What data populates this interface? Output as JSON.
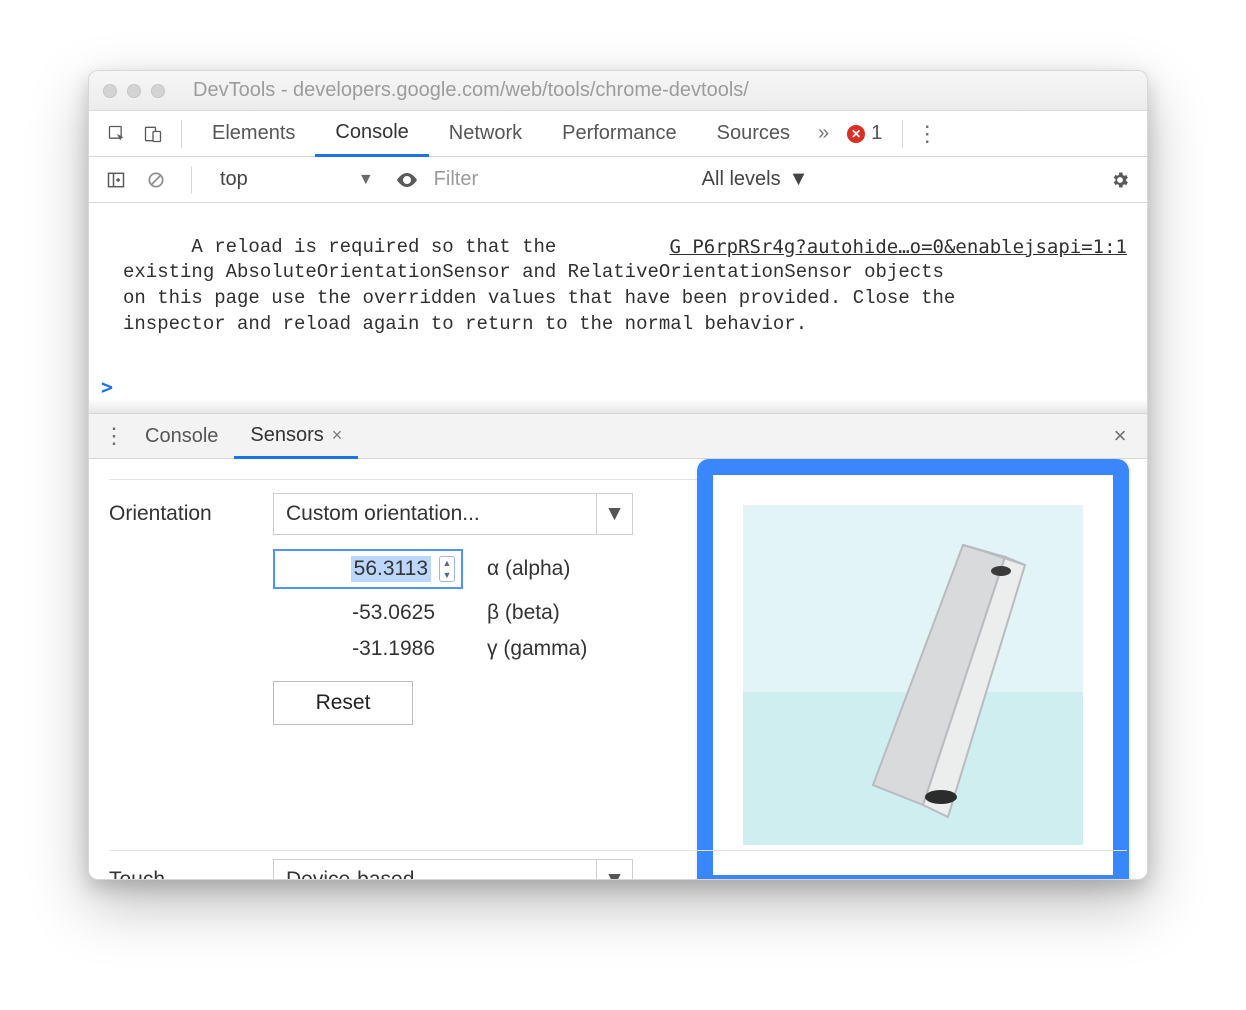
{
  "window": {
    "title": "DevTools - developers.google.com/web/tools/chrome-devtools/"
  },
  "tabs": {
    "items": [
      "Elements",
      "Console",
      "Network",
      "Performance",
      "Sources"
    ],
    "active": "Console",
    "overflow_glyph": "»",
    "error_count": "1"
  },
  "console_toolbar": {
    "context": "top",
    "filter_placeholder": "Filter",
    "levels_label": "All levels"
  },
  "console": {
    "source_link": "G P6rpRSr4g?autohide…o=0&enablejsapi=1:1",
    "msg_line1_prefix": "A reload is required so that the ",
    "msg_line2": "existing AbsoluteOrientationSensor and RelativeOrientationSensor objects",
    "msg_line3": "on this page use the overridden values that have been provided. Close the",
    "msg_line4": "inspector and reload again to return to the normal behavior.",
    "prompt": ">"
  },
  "drawer": {
    "tabs": [
      "Console",
      "Sensors"
    ],
    "active": "Sensors"
  },
  "sensors": {
    "orientation_label": "Orientation",
    "orientation_select": "Custom orientation...",
    "alpha": {
      "value": "56.3113",
      "label": "α (alpha)"
    },
    "beta": {
      "value": "-53.0625",
      "label": "β (beta)"
    },
    "gamma": {
      "value": "-31.1986",
      "label": "γ (gamma)"
    },
    "reset_label": "Reset",
    "touch_label": "Touch",
    "touch_select": "Device-based"
  }
}
